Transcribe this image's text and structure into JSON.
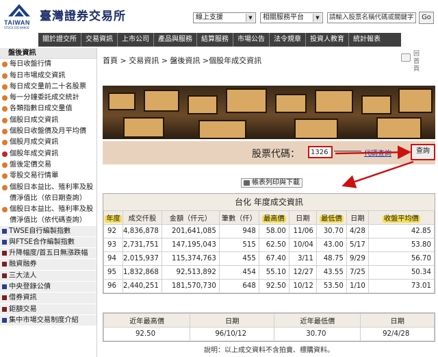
{
  "header": {
    "logo_text": "TAIWAN",
    "logo_sub": "STOCK EXCHANGE",
    "site_title": "臺灣證券交易所",
    "select1": "線上支援",
    "select2": "相關服務平台",
    "search_placeholder": "請輸入股票名稱代碼或關鍵字",
    "go": "Go"
  },
  "nav": [
    "關於證交所",
    "交易資訊",
    "上市公司",
    "產品與服務",
    "結算服務",
    "市場公告",
    "法令規章",
    "投資人教育",
    "統計報表"
  ],
  "sidebar": {
    "section": "盤後資訊",
    "items": [
      "每日收盤行情",
      "每日市場成交資訊",
      "每日成交量前二十名股票",
      "每一分鐘委託成交統計",
      "各類指數日成交量值",
      "個股日成交資訊",
      "個股日收盤價及月平均價",
      "個股月成交資訊",
      "個股年成交資訊",
      "盤後定價交易",
      "零股交易行情單",
      "個股日本益比、殖利率及股價淨值比（依日期查詢）",
      "個股日本益比、殖利率及股價淨值比（依代碼查詢）"
    ],
    "categories": [
      "TWSE自行編製指數",
      "與FTSE合作編製指數",
      "升降幅度/首五日無漲跌幅",
      "融資融券",
      "三大法人",
      "中央登錄公債",
      "借券資訊",
      "鉅額交易",
      "集中市場交易制度介紹"
    ]
  },
  "main": {
    "breadcrumb": "首頁 > 交易資訊 > 盤後資訊 >個股年成交資訊",
    "tools_label": "回首頁",
    "query_label": "股票代碼：",
    "query_value": "1326",
    "code_lookup": "代碼查詢",
    "query_button": "查詢",
    "print_button": "帳表列印與下載",
    "table_title": "台化 年度成交資訊",
    "columns": [
      "年度",
      "成交仟股",
      "金額（仟元）",
      "筆數（仟）",
      "最高價",
      "日期",
      "最低價",
      "日期",
      "收盤平均價"
    ],
    "rows": [
      [
        "92",
        "4,836,878",
        "201,641,085",
        "948",
        "58.00",
        "11/06",
        "30.70",
        "4/28",
        "42.85"
      ],
      [
        "93",
        "2,731,751",
        "147,195,043",
        "515",
        "62.50",
        "10/04",
        "43.00",
        "5/17",
        "53.80"
      ],
      [
        "94",
        "2,015,937",
        "115,374,763",
        "455",
        "67.40",
        "3/11",
        "48.75",
        "9/29",
        "56.70"
      ],
      [
        "95",
        "1,832,868",
        "92,513,892",
        "454",
        "55.10",
        "12/27",
        "43.55",
        "7/25",
        "50.34"
      ],
      [
        "96",
        "2,440,251",
        "181,570,730",
        "648",
        "92.50",
        "10/12",
        "53.50",
        "1/10",
        "73.01"
      ]
    ],
    "summary_headers": [
      "近年最高價",
      "日期",
      "近年最低價",
      "日期"
    ],
    "summary_values": [
      "92.50",
      "96/10/12",
      "30.70",
      "92/4/28"
    ],
    "note": "說明：以上成交資料不含拍賣、標購資料。"
  },
  "colors": {
    "nav_bg": "#3f3f3f",
    "highlight": "#f5dd4a",
    "annotation": "#cc1111",
    "query_bg": "#e9d2bd"
  }
}
